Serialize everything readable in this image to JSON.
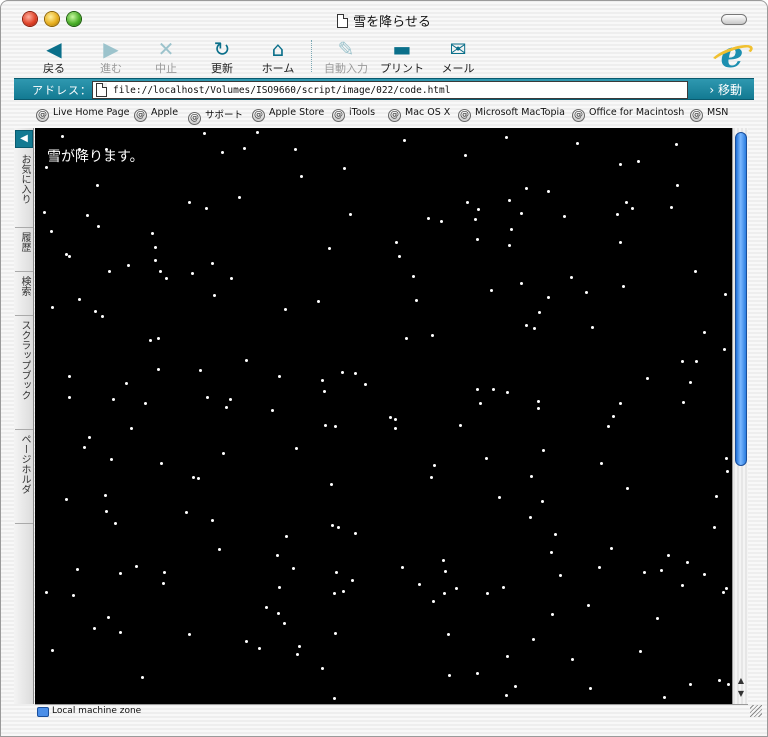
{
  "window": {
    "title": "雪を降らせる"
  },
  "toolbar": {
    "buttons": [
      {
        "label": "戻る",
        "icon": "back-arrow-icon",
        "enabled": true
      },
      {
        "label": "進む",
        "icon": "forward-arrow-icon",
        "enabled": false
      },
      {
        "label": "中止",
        "icon": "stop-x-icon",
        "enabled": false
      },
      {
        "label": "更新",
        "icon": "refresh-icon",
        "enabled": true
      },
      {
        "label": "ホーム",
        "icon": "home-icon",
        "enabled": true
      },
      {
        "label": "自動入力",
        "icon": "autofill-icon",
        "enabled": false
      },
      {
        "label": "プリント",
        "icon": "printer-icon",
        "enabled": true
      },
      {
        "label": "メール",
        "icon": "mail-icon",
        "enabled": true
      }
    ]
  },
  "address": {
    "label": "アドレス：",
    "url": "file://localhost/Volumes/ISO9660/script/image/022/code.html",
    "go_label": "移動"
  },
  "favorites": [
    "Live Home Page",
    "Apple",
    "サポート",
    "Apple Store",
    "iTools",
    "Mac OS X",
    "Microsoft MacTopia",
    "Office for Macintosh",
    "MSN"
  ],
  "sidebar": {
    "tabs": [
      "お気に入り",
      "履歴",
      "検索",
      "スクラップブック",
      "ページホルダ"
    ]
  },
  "content": {
    "heading": "雪が降ります。"
  },
  "status": {
    "zone": "Local machine zone"
  },
  "colors": {
    "accent": "#137a92",
    "content_background": "#000000",
    "snow": "#ffffff"
  }
}
